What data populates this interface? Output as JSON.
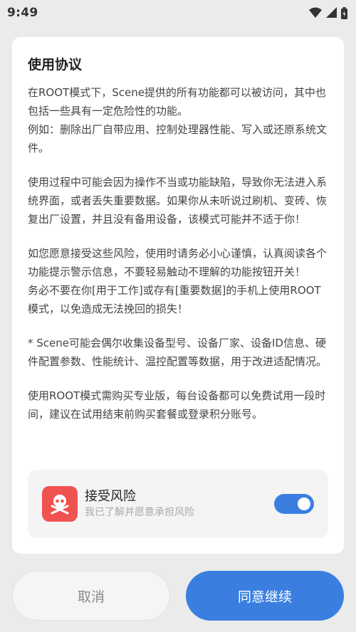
{
  "status_bar": {
    "time": "9:49"
  },
  "dialog": {
    "title": "使用协议",
    "paragraphs": [
      "在ROOT模式下，Scene提供的所有功能都可以被访问，其中也包括一些具有一定危险性的功能。\n例如：删除出厂自带应用、控制处理器性能、写入或还原系统文件。",
      "使用过程中可能会因为操作不当或功能缺陷，导致你无法进入系统界面，或者丢失重要数据。如果你从未听说过刷机、变砖、恢复出厂设置，并且没有备用设备，该模式可能并不适于你！",
      "如您愿意接受这些风险，使用时请务必小心谨慎，认真阅读各个功能提示警示信息，不要轻易触动不理解的功能按钮开关！\n务必不要在你[用于工作]或存有[重要数据]的手机上使用ROOT模式，以免造成无法挽回的损失！",
      "* Scene可能会偶尔收集设备型号、设备厂家、设备ID信息、硬件配置参数、性能统计、温控配置等数据，用于改进适配情况。",
      "使用ROOT模式需购买专业版，每台设备都可以免费试用一段时间，建议在试用结束前购买套餐或登录积分账号。"
    ],
    "accept": {
      "title": "接受风险",
      "subtitle": "我已了解并愿意承担风险",
      "toggle_on": true,
      "icon": "skull-crossbones-icon",
      "icon_color": "#ef5350"
    }
  },
  "buttons": {
    "cancel": "取消",
    "continue": "同意继续"
  },
  "colors": {
    "accent": "#3a7fe0",
    "danger": "#ef5350"
  }
}
